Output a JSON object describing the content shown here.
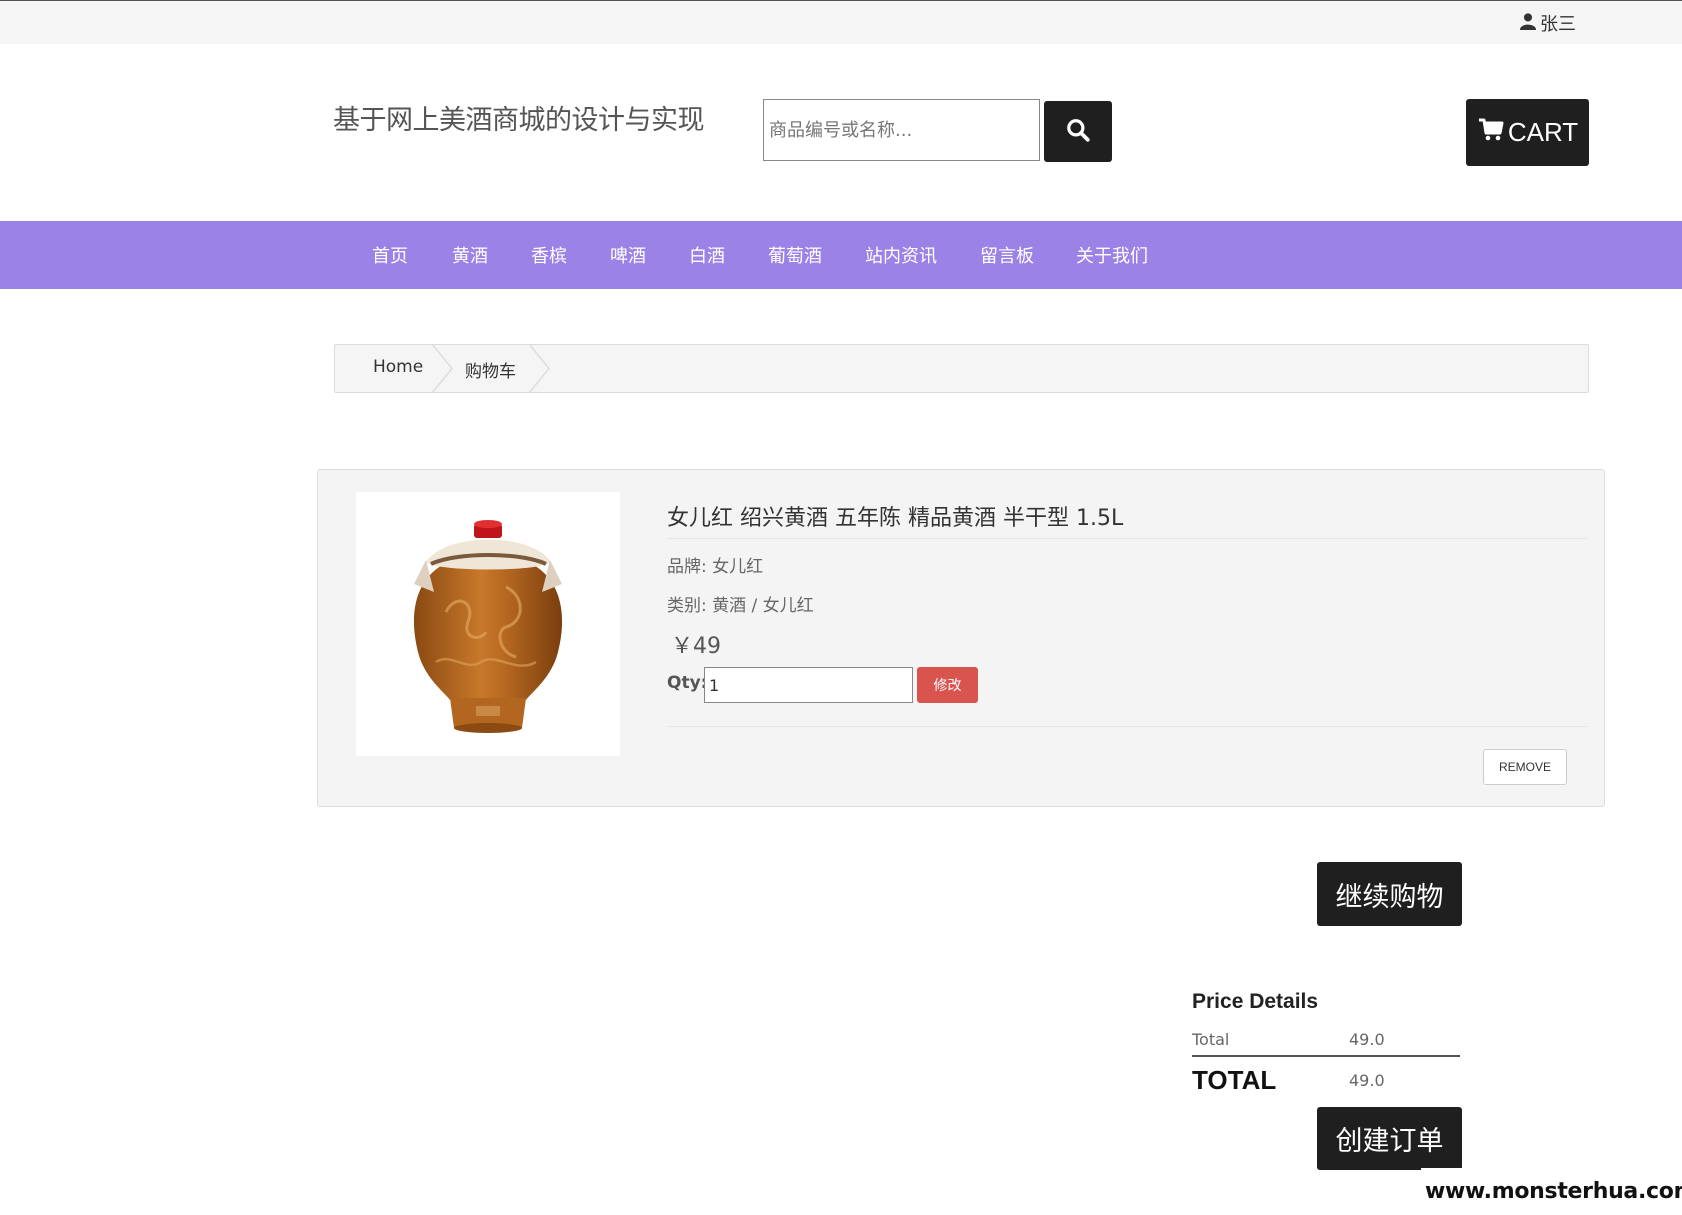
{
  "topbar": {
    "username": "张三",
    "user_icon": "user-icon"
  },
  "header": {
    "site_title": "基于网上美酒商城的设计与实现",
    "search_placeholder": "商品编号或名称...",
    "search_icon": "search-icon",
    "cart_label": "CART",
    "cart_icon": "cart-icon"
  },
  "nav": {
    "items": [
      {
        "label": "首页"
      },
      {
        "label": "黄酒"
      },
      {
        "label": "香槟"
      },
      {
        "label": "啤酒"
      },
      {
        "label": "白酒"
      },
      {
        "label": "葡萄酒"
      },
      {
        "label": "站内资讯"
      },
      {
        "label": "留言板"
      },
      {
        "label": "关于我们"
      }
    ],
    "background": "#9b82e6"
  },
  "breadcrumb": {
    "items": [
      {
        "label": "Home"
      },
      {
        "label": "购物车"
      }
    ]
  },
  "cart_item": {
    "title": "女儿红 绍兴黄酒 五年陈 精品黄酒 半干型 1.5L",
    "brand": "品牌: 女儿红",
    "category": "类别:  黄酒 / 女儿红",
    "price": "￥49",
    "qty_label": "Qty:",
    "qty_value": "1",
    "modify_label": "修改",
    "remove_label": "REMOVE",
    "image_alt": "product-jar-image"
  },
  "continue_label": "继续购物",
  "price_details": {
    "title": "Price Details",
    "total_label": "Total",
    "total_value": "49.0",
    "grand_label": "TOTAL",
    "grand_value": "49.0"
  },
  "order_label": "创建订单",
  "watermark": "www.monsterhua.com",
  "colors": {
    "nav": "#9b82e6",
    "dark_button": "#1f1f1f",
    "modify_button": "#d9534f"
  }
}
